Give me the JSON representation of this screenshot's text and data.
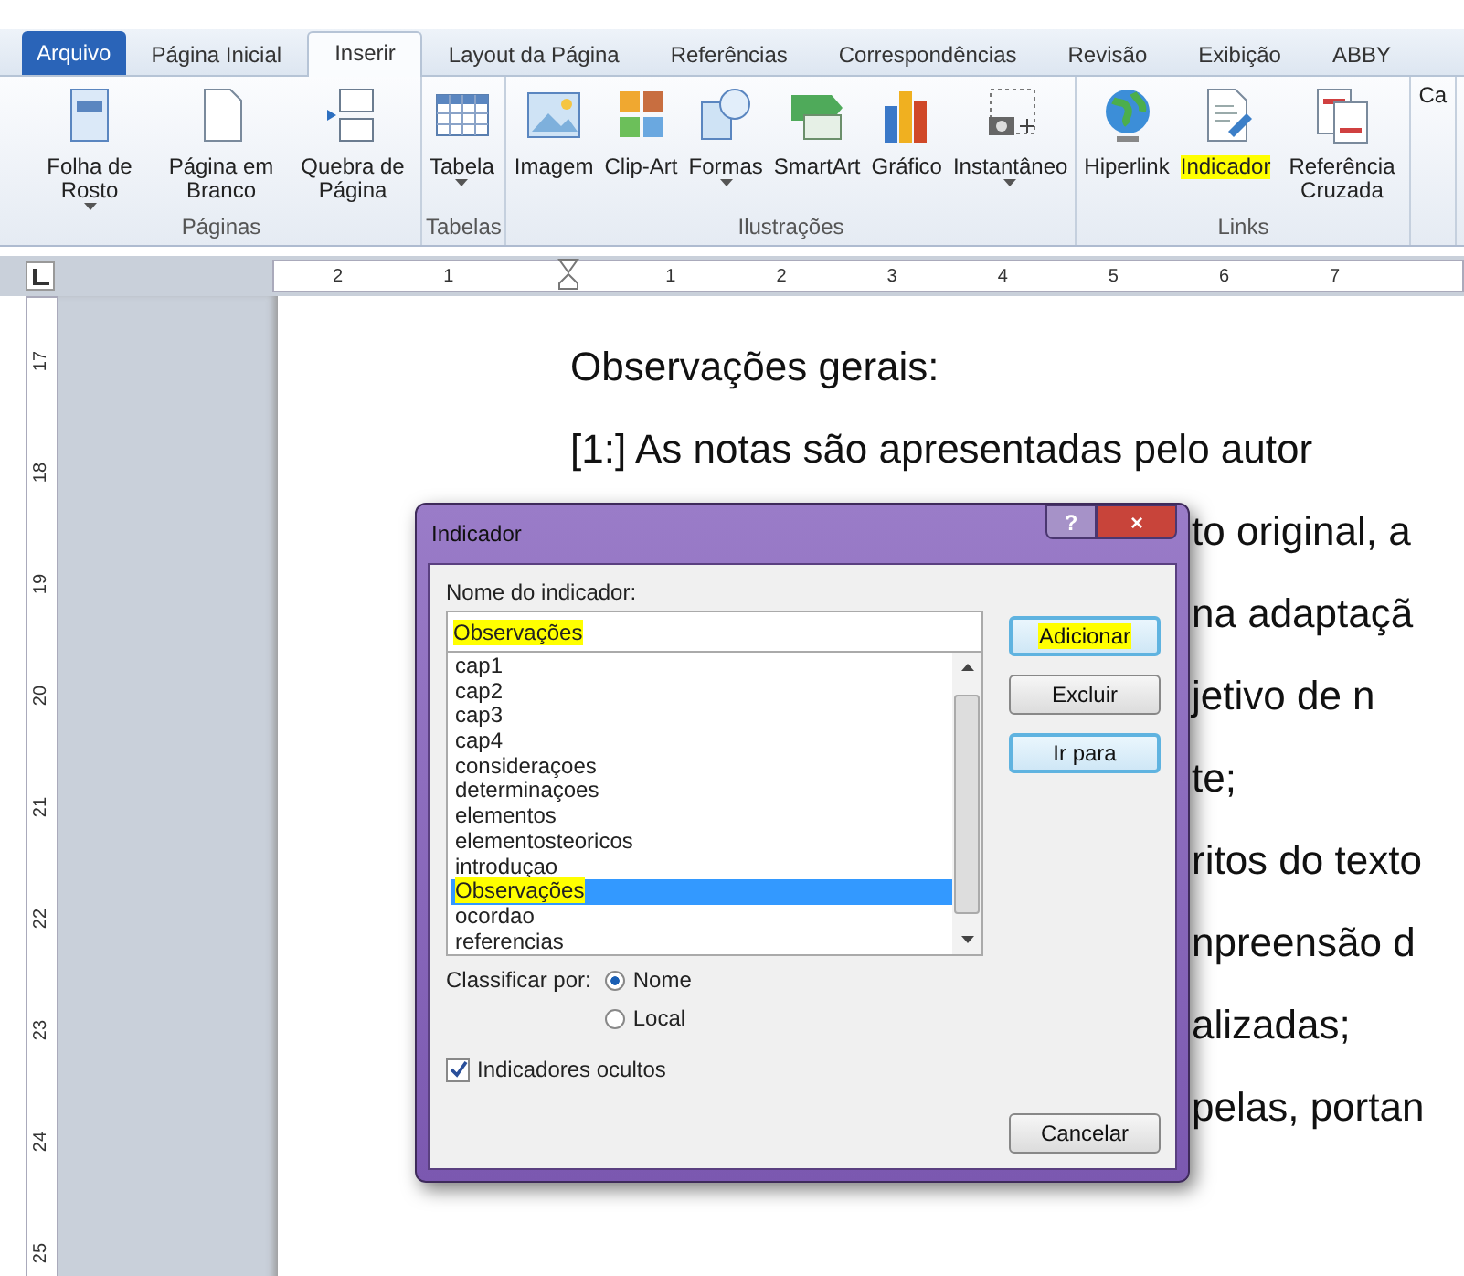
{
  "tabs": [
    {
      "label": "Arquivo",
      "kind": "file",
      "selected": false
    },
    {
      "label": "Página Inicial",
      "kind": "tab",
      "selected": false
    },
    {
      "label": "Inserir",
      "kind": "tab",
      "selected": true
    },
    {
      "label": "Layout da Página",
      "kind": "tab",
      "selected": false
    },
    {
      "label": "Referências",
      "kind": "tab",
      "selected": false
    },
    {
      "label": "Correspondências",
      "kind": "tab",
      "selected": false
    },
    {
      "label": "Revisão",
      "kind": "tab",
      "selected": false
    },
    {
      "label": "Exibição",
      "kind": "tab",
      "selected": false
    },
    {
      "label": "ABBY",
      "kind": "tab",
      "selected": false
    }
  ],
  "ribbon": {
    "groups": [
      {
        "label": "Páginas",
        "buttons": [
          {
            "label": "Folha de Rosto",
            "dropdown": true,
            "highlighted": false
          },
          {
            "label": "Página em Branco",
            "dropdown": false,
            "highlighted": false
          },
          {
            "label": "Quebra de Página",
            "dropdown": false,
            "highlighted": false
          }
        ]
      },
      {
        "label": "Tabelas",
        "buttons": [
          {
            "label": "Tabela",
            "dropdown": true,
            "highlighted": false
          }
        ]
      },
      {
        "label": "Ilustrações",
        "buttons": [
          {
            "label": "Imagem",
            "dropdown": false,
            "highlighted": false
          },
          {
            "label": "Clip-Art",
            "dropdown": false,
            "highlighted": false
          },
          {
            "label": "Formas",
            "dropdown": true,
            "highlighted": false
          },
          {
            "label": "SmartArt",
            "dropdown": false,
            "highlighted": false
          },
          {
            "label": "Gráfico",
            "dropdown": false,
            "highlighted": false
          },
          {
            "label": "Instantâneo",
            "dropdown": true,
            "highlighted": false
          }
        ]
      },
      {
        "label": "Links",
        "buttons": [
          {
            "label": "Hiperlink",
            "dropdown": false,
            "highlighted": false
          },
          {
            "label": "Indicador",
            "dropdown": false,
            "highlighted": true
          },
          {
            "label": "Referência Cruzada",
            "dropdown": false,
            "highlighted": false
          }
        ]
      },
      {
        "buttons": [
          {
            "label": "Ca",
            "dropdown": false,
            "highlighted": false
          }
        ]
      }
    ]
  },
  "ruler": {
    "numbers": [
      "2",
      "1",
      "1",
      "2",
      "3",
      "4",
      "5",
      "6",
      "7"
    ]
  },
  "vertical_ruler": {
    "numbers": [
      "17",
      "18",
      "19",
      "20",
      "21",
      "22",
      "23",
      "24",
      "25"
    ]
  },
  "document": {
    "lines": [
      {
        "text": "Observações gerais:",
        "kind": "full"
      },
      {
        "text": "[1:] As notas são apresentadas pelo autor",
        "kind": "full"
      },
      {
        "text": "to original, a",
        "kind": "covered"
      },
      {
        "text": "na adaptaçã",
        "kind": "covered"
      },
      {
        "text": "jetivo de n",
        "kind": "covered"
      },
      {
        "text": "te;",
        "kind": "covered"
      },
      {
        "text": "ritos do texto",
        "kind": "covered"
      },
      {
        "text": "npreensão d",
        "kind": "covered"
      },
      {
        "text": "alizadas;",
        "kind": "covered"
      },
      {
        "text": "pelas, portan",
        "kind": "covered"
      }
    ]
  },
  "dialog": {
    "title": "Indicador",
    "help": "?",
    "close": "×",
    "name_label": "Nome do indicador:",
    "name_value": "Observações",
    "name_highlighted": true,
    "items": [
      {
        "label": "cap1",
        "selected": false,
        "highlighted": false
      },
      {
        "label": "cap2",
        "selected": false,
        "highlighted": false
      },
      {
        "label": "cap3",
        "selected": false,
        "highlighted": false
      },
      {
        "label": "cap4",
        "selected": false,
        "highlighted": false
      },
      {
        "label": "consideraçoes",
        "selected": false,
        "highlighted": false
      },
      {
        "label": "determinaçoes",
        "selected": false,
        "highlighted": false
      },
      {
        "label": "elementos",
        "selected": false,
        "highlighted": false
      },
      {
        "label": "elementosteoricos",
        "selected": false,
        "highlighted": false
      },
      {
        "label": "introduçao",
        "selected": false,
        "highlighted": false
      },
      {
        "label": "Observações",
        "selected": true,
        "highlighted": true
      },
      {
        "label": "ocordao",
        "selected": false,
        "highlighted": false
      },
      {
        "label": "referencias",
        "selected": false,
        "highlighted": false
      }
    ],
    "side_buttons": [
      {
        "label": "Adicionar",
        "default": true,
        "highlighted": true
      },
      {
        "label": "Excluir",
        "default": false,
        "highlighted": false
      },
      {
        "label": "Ir para",
        "default": true,
        "highlighted": false
      }
    ],
    "sort_label": "Classificar por:",
    "sort_options": [
      {
        "label": "Nome",
        "selected": true
      },
      {
        "label": "Local",
        "selected": false
      }
    ],
    "hidden": {
      "label": "Indicadores ocultos",
      "checked": true
    },
    "cancel": "Cancelar"
  }
}
